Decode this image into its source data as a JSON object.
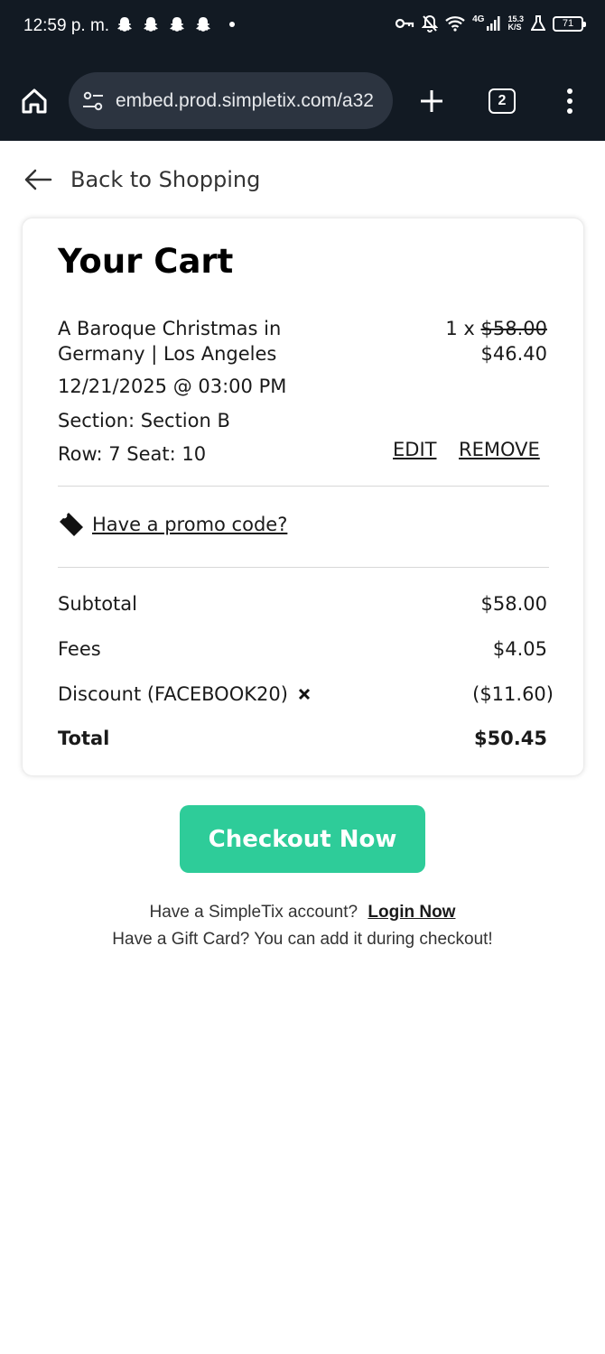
{
  "status_bar": {
    "time": "12:59 p. m.",
    "network": "4G",
    "speed_value": "15.3",
    "speed_unit": "K/S",
    "battery": "71"
  },
  "browser": {
    "url": "embed.prod.simpletix.com/a32",
    "tab_count": "2"
  },
  "nav": {
    "back_label": "Back to Shopping"
  },
  "cart": {
    "title": "Your Cart",
    "item": {
      "name": "A Baroque Christmas in Germany | Los Angeles",
      "quantity": "1 x",
      "original_price": "$58.00",
      "price": "$46.40",
      "datetime": "12/21/2025 @ 03:00 PM",
      "section": "Section: Section B",
      "seat": "Row: 7 Seat: 10",
      "edit_label": "EDIT",
      "remove_label": "REMOVE"
    },
    "promo_label": "Have a promo code?",
    "summary": {
      "subtotal_label": "Subtotal",
      "subtotal_value": "$58.00",
      "fees_label": "Fees",
      "fees_value": "$4.05",
      "discount_label": "Discount (FACEBOOK20)",
      "discount_value": "($11.60)",
      "total_label": "Total",
      "total_value": "$50.45"
    }
  },
  "checkout": {
    "button_label": "Checkout Now",
    "account_prompt": "Have a SimpleTix account?",
    "login_label": "Login Now",
    "gift_card_text": "Have a Gift Card? You can add it during checkout!"
  },
  "colors": {
    "accent": "#2ecc99",
    "browser_bg": "#121a23",
    "url_bg": "#2c3440"
  }
}
